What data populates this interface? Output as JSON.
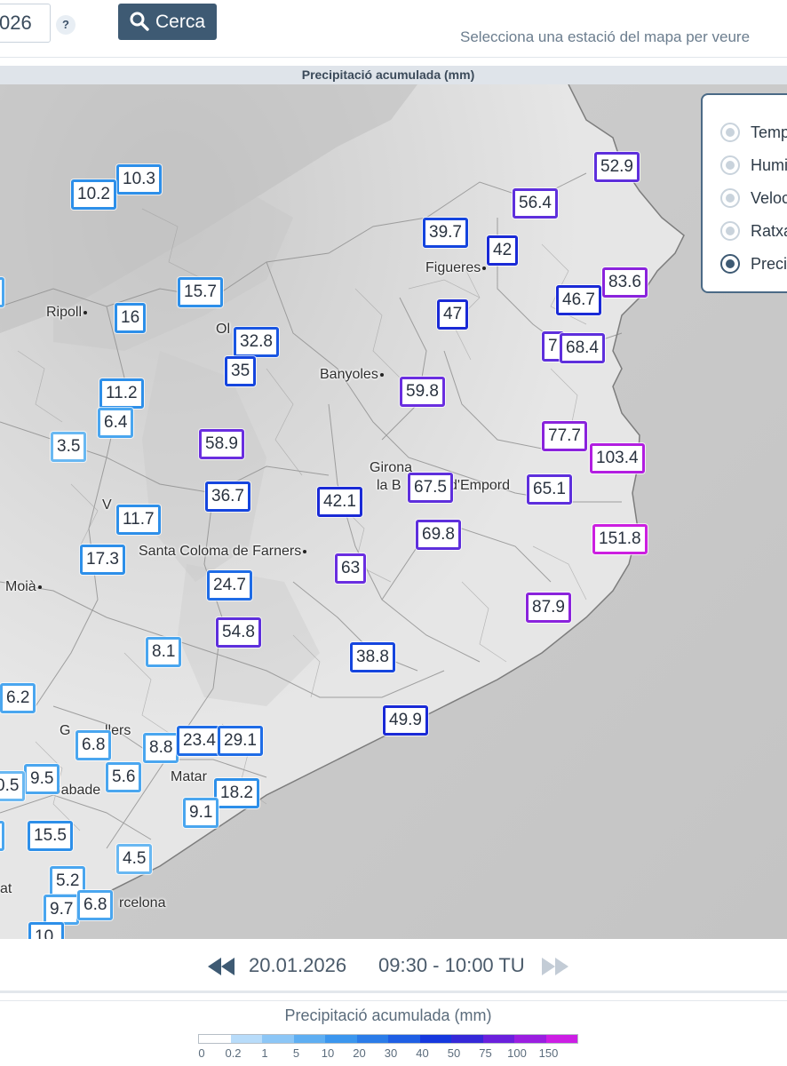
{
  "toolbar": {
    "date_value": "026",
    "help_label": "?",
    "search_label": "Cerca",
    "hint": "Selecciona una estació del mapa per veure"
  },
  "map": {
    "title": "Precipitació acumulada (mm)",
    "towns": [
      {
        "name": "Ripoll",
        "dot": true
      },
      {
        "name": "Ol",
        "dot": false
      },
      {
        "name": "Figueres",
        "dot": true
      },
      {
        "name": "Banyoles",
        "dot": true
      },
      {
        "name": "Girona",
        "dot": false
      },
      {
        "name": "la B",
        "dot": false
      },
      {
        "name": "d'Empord",
        "dot": false
      },
      {
        "name": "Santa Coloma de Farners",
        "dot": true
      },
      {
        "name": "V",
        "dot": false
      },
      {
        "name": "Moià",
        "dot": true
      },
      {
        "name": "G",
        "dot": false
      },
      {
        "name": "llers",
        "dot": false
      },
      {
        "name": "Sabade",
        "dot": false
      },
      {
        "name": "Matar",
        "dot": false
      },
      {
        "name": "rcelona",
        "dot": false
      },
      {
        "name": "at",
        "dot": false
      }
    ],
    "stations": [
      {
        "value": "10.3",
        "color": "#2d8fe9"
      },
      {
        "value": "10.2",
        "color": "#2d8fe9"
      },
      {
        "value": "15.7",
        "color": "#2d8fe9"
      },
      {
        "value": "16",
        "color": "#2d8fe9"
      },
      {
        "value": "6",
        "color": "#4aa6ef"
      },
      {
        "value": "32.8",
        "color": "#1a56e2"
      },
      {
        "value": "35",
        "color": "#1545de"
      },
      {
        "value": "11.2",
        "color": "#2d8fe9"
      },
      {
        "value": "6.4",
        "color": "#4aa6ef"
      },
      {
        "value": "3.5",
        "color": "#69b8f2"
      },
      {
        "value": "58.9",
        "color": "#6a2ee0"
      },
      {
        "value": "36.7",
        "color": "#1545de"
      },
      {
        "value": "11.7",
        "color": "#2d8fe9"
      },
      {
        "value": "17.3",
        "color": "#2d8fe9"
      },
      {
        "value": "24.7",
        "color": "#1f6ce6"
      },
      {
        "value": "54.8",
        "color": "#5e2fdc"
      },
      {
        "value": "8.1",
        "color": "#4aa6ef"
      },
      {
        "value": "6.2",
        "color": "#4aa6ef"
      },
      {
        "value": "6.8",
        "color": "#4aa6ef"
      },
      {
        "value": "8.8",
        "color": "#4aa6ef"
      },
      {
        "value": "23.4",
        "color": "#1f6ce6"
      },
      {
        "value": "29.1",
        "color": "#1f6ce6"
      },
      {
        "value": "9.5",
        "color": "#4aa6ef"
      },
      {
        "value": "0.5",
        "color": "#69b8f2"
      },
      {
        "value": "5.6",
        "color": "#4aa6ef"
      },
      {
        "value": "18.2",
        "color": "#2d8fe9"
      },
      {
        "value": "9.1",
        "color": "#4aa6ef"
      },
      {
        "value": "15.5",
        "color": "#2d8fe9"
      },
      {
        "value": "5",
        "color": "#4aa6ef"
      },
      {
        "value": "4.5",
        "color": "#69b8f2"
      },
      {
        "value": "5.2",
        "color": "#4aa6ef"
      },
      {
        "value": "9.7",
        "color": "#4aa6ef"
      },
      {
        "value": "6.8",
        "color": "#4aa6ef"
      },
      {
        "value": "10.",
        "color": "#2d8fe9"
      },
      {
        "value": "52.9",
        "color": "#5e2fdc"
      },
      {
        "value": "56.4",
        "color": "#5e2fdc"
      },
      {
        "value": "39.7",
        "color": "#1545de"
      },
      {
        "value": "42",
        "color": "#1a2ad6"
      },
      {
        "value": "83.6",
        "color": "#8a23dc"
      },
      {
        "value": "46.7",
        "color": "#1a2ad6"
      },
      {
        "value": "47",
        "color": "#1a2ad6"
      },
      {
        "value": "7",
        "color": "#5e2fdc"
      },
      {
        "value": "68.4",
        "color": "#5e2fdc"
      },
      {
        "value": "59.8",
        "color": "#6a2ee0"
      },
      {
        "value": "77.7",
        "color": "#8a23dc"
      },
      {
        "value": "103.4",
        "color": "#b21ee0"
      },
      {
        "value": "42.1",
        "color": "#1a2ad6"
      },
      {
        "value": "67.5",
        "color": "#5e2fdc"
      },
      {
        "value": "65.1",
        "color": "#5e2fdc"
      },
      {
        "value": "69.8",
        "color": "#5e2fdc"
      },
      {
        "value": "151.8",
        "color": "#cc1fe0"
      },
      {
        "value": "63",
        "color": "#6a2ee0"
      },
      {
        "value": "87.9",
        "color": "#8a23dc"
      },
      {
        "value": "38.8",
        "color": "#1545de"
      },
      {
        "value": "49.9",
        "color": "#1a2ad6"
      }
    ]
  },
  "variables": [
    {
      "label": "Temp",
      "selected": false
    },
    {
      "label": "Humi",
      "selected": false
    },
    {
      "label": "Veloc",
      "selected": false
    },
    {
      "label": "Ratxa",
      "selected": false
    },
    {
      "label": "Precip",
      "selected": true
    }
  ],
  "time_nav": {
    "date": "20.01.2026",
    "interval": "09:30 - 10:00 TU"
  },
  "legend": {
    "title": "Precipitació acumulada (mm)",
    "labels": [
      "0",
      "0.2",
      "1",
      "5",
      "10",
      "20",
      "30",
      "40",
      "50",
      "75",
      "100",
      "150"
    ],
    "colors": [
      "#ffffff",
      "#b8dcfa",
      "#8cc6f6",
      "#5eaef2",
      "#3b96ee",
      "#2b7ce8",
      "#1f5fe4",
      "#1538de",
      "#3528d8",
      "#6a20dc",
      "#9a1ee0",
      "#cc1ee4"
    ]
  }
}
